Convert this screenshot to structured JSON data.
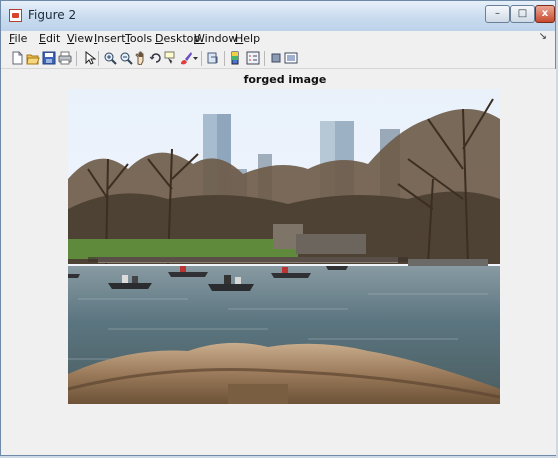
{
  "window": {
    "title": "Figure 2",
    "controls": {
      "minimize": "–",
      "maximize": "□",
      "close": "x"
    }
  },
  "menu": {
    "items": [
      {
        "acc": "F",
        "rest": "ile"
      },
      {
        "acc": "E",
        "rest": "dit"
      },
      {
        "acc": "V",
        "rest": "iew"
      },
      {
        "acc": "I",
        "rest": "nsert"
      },
      {
        "acc": "T",
        "rest": "ools"
      },
      {
        "acc": "D",
        "rest": "esktop"
      },
      {
        "acc": "W",
        "rest": "indow"
      },
      {
        "acc": "H",
        "rest": "elp"
      }
    ],
    "overflow_glyph": "↘"
  },
  "toolbar": {
    "icons": [
      "new-file-icon",
      "open-folder-icon",
      "save-icon",
      "print-icon",
      "select-arrow-icon",
      "zoom-in-icon",
      "zoom-out-icon",
      "pan-hand-icon",
      "rotate-3d-icon",
      "data-cursor-icon",
      "brush-icon",
      "brush-dropdown-icon",
      "link-plot-icon",
      "insert-colorbar-icon",
      "insert-legend-icon",
      "hide-plot-tools-icon",
      "show-plot-tools-icon"
    ]
  },
  "axes": {
    "title": "forged image"
  },
  "colors": {
    "sky": "#eef4fb",
    "water": "#58707c",
    "log": "#a98a6b",
    "trees": "#5b4a3a"
  }
}
